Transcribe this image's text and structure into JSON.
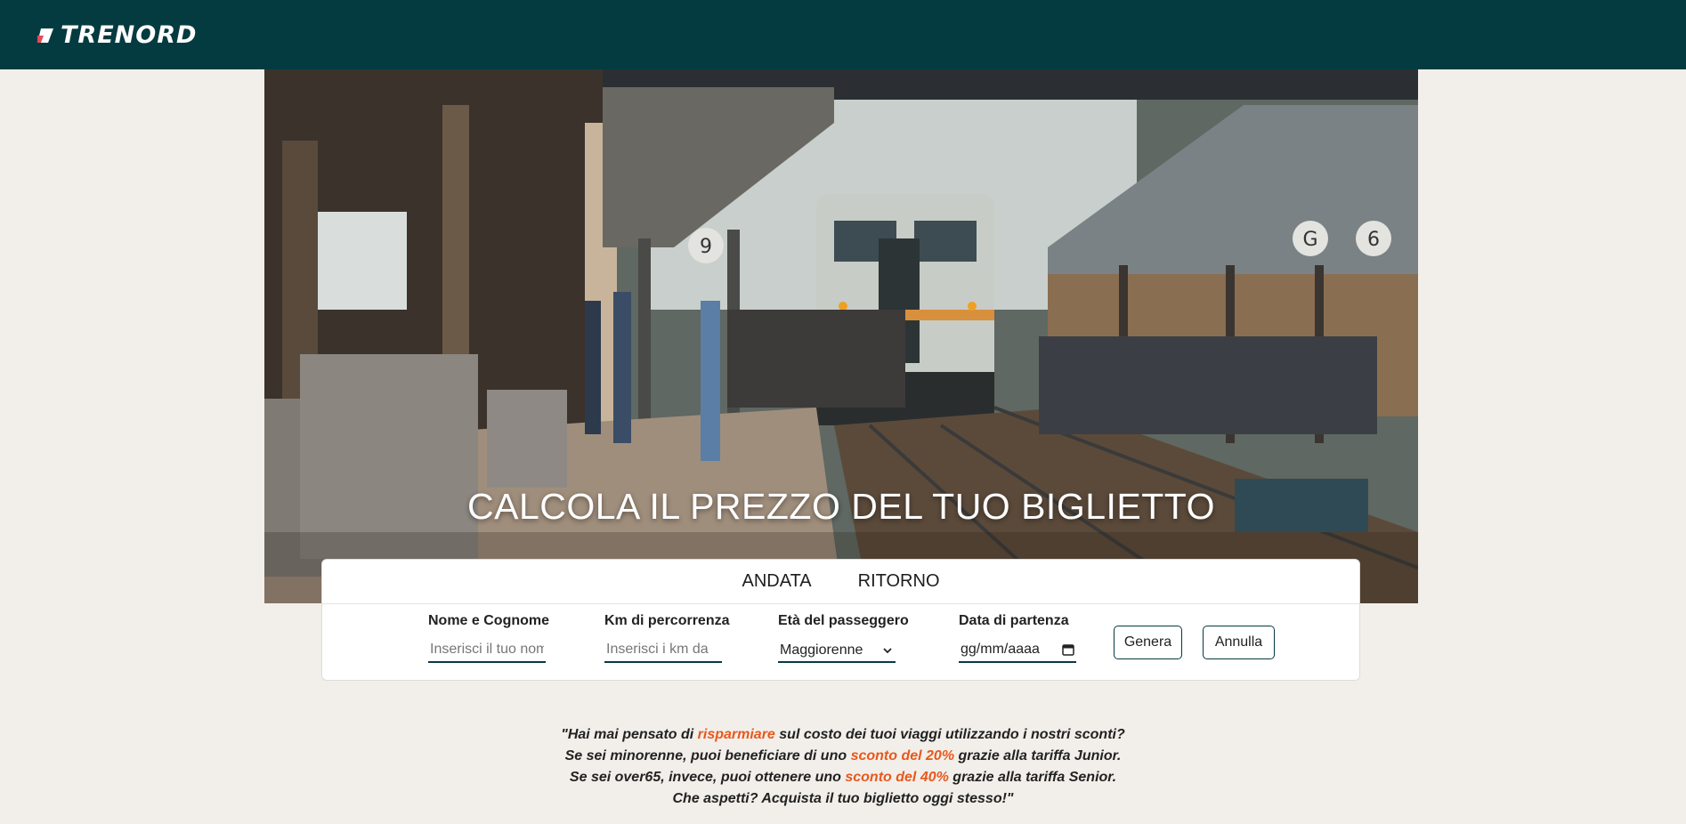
{
  "header": {
    "brand": "TRENORD",
    "brand_color": "#033b41",
    "accent_color": "#e8581c"
  },
  "hero": {
    "title": "CALCOLA IL PREZZO DEL TUO BIGLIETTO",
    "image_alt": "train-station-photo",
    "platform_numbers": [
      "9",
      "G",
      "6"
    ]
  },
  "tabs": [
    {
      "label": "ANDATA"
    },
    {
      "label": "RITORNO"
    }
  ],
  "form": {
    "name": {
      "label": "Nome e Cognome",
      "placeholder": "Inserisci il tuo nome"
    },
    "km": {
      "label": "Km di percorrenza",
      "placeholder": "Inserisci i km da"
    },
    "age": {
      "label": "Età del passeggero",
      "value": "Maggiorenne"
    },
    "date": {
      "label": "Data di partenza",
      "value": "gg/mm/aaaa"
    },
    "generate_label": "Genera",
    "cancel_label": "Annulla"
  },
  "promo": {
    "l1_a": "\"Hai mai pensato di ",
    "l1_hl": "risparmiare",
    "l1_b": " sul costo dei tuoi viaggi utilizzando i nostri sconti?",
    "l2_a": "Se sei minorenne, puoi beneficiare di uno ",
    "l2_hl": "sconto del 20%",
    "l2_b": " grazie alla tariffa Junior.",
    "l3_a": "Se sei over65, invece, puoi ottenere uno ",
    "l3_hl": "sconto del 40%",
    "l3_b": " grazie alla tariffa Senior.",
    "l4": "Che aspetti? Acquista il tuo biglietto oggi stesso!\""
  }
}
